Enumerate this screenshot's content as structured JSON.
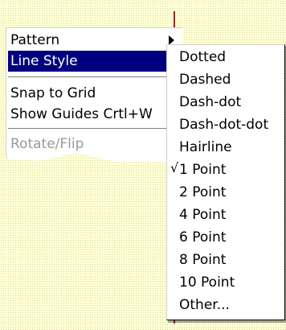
{
  "menu": {
    "items": [
      {
        "label": "Pattern",
        "has_submenu": true
      },
      {
        "label": "Line Style",
        "has_submenu": true,
        "highlighted": true
      },
      {
        "label": "Snap to Grid"
      },
      {
        "label": "Show Guides Crtl+W"
      },
      {
        "label": "Rotate/Flip",
        "disabled": true
      }
    ]
  },
  "submenu": {
    "check_mark": "√",
    "items": [
      {
        "label": "Dotted"
      },
      {
        "label": "Dashed"
      },
      {
        "label": "Dash-dot"
      },
      {
        "label": "Dash-dot-dot"
      },
      {
        "label": "Hairline"
      },
      {
        "label": "1 Point",
        "checked": true
      },
      {
        "label": "2 Point"
      },
      {
        "label": "4 Point"
      },
      {
        "label": "6 Point"
      },
      {
        "label": "8 Point"
      },
      {
        "label": "10 Point"
      },
      {
        "label": "Other..."
      }
    ]
  },
  "colors": {
    "highlight": "#000080",
    "background": "#ffffd4",
    "guide_line": "#8e2a2a"
  }
}
